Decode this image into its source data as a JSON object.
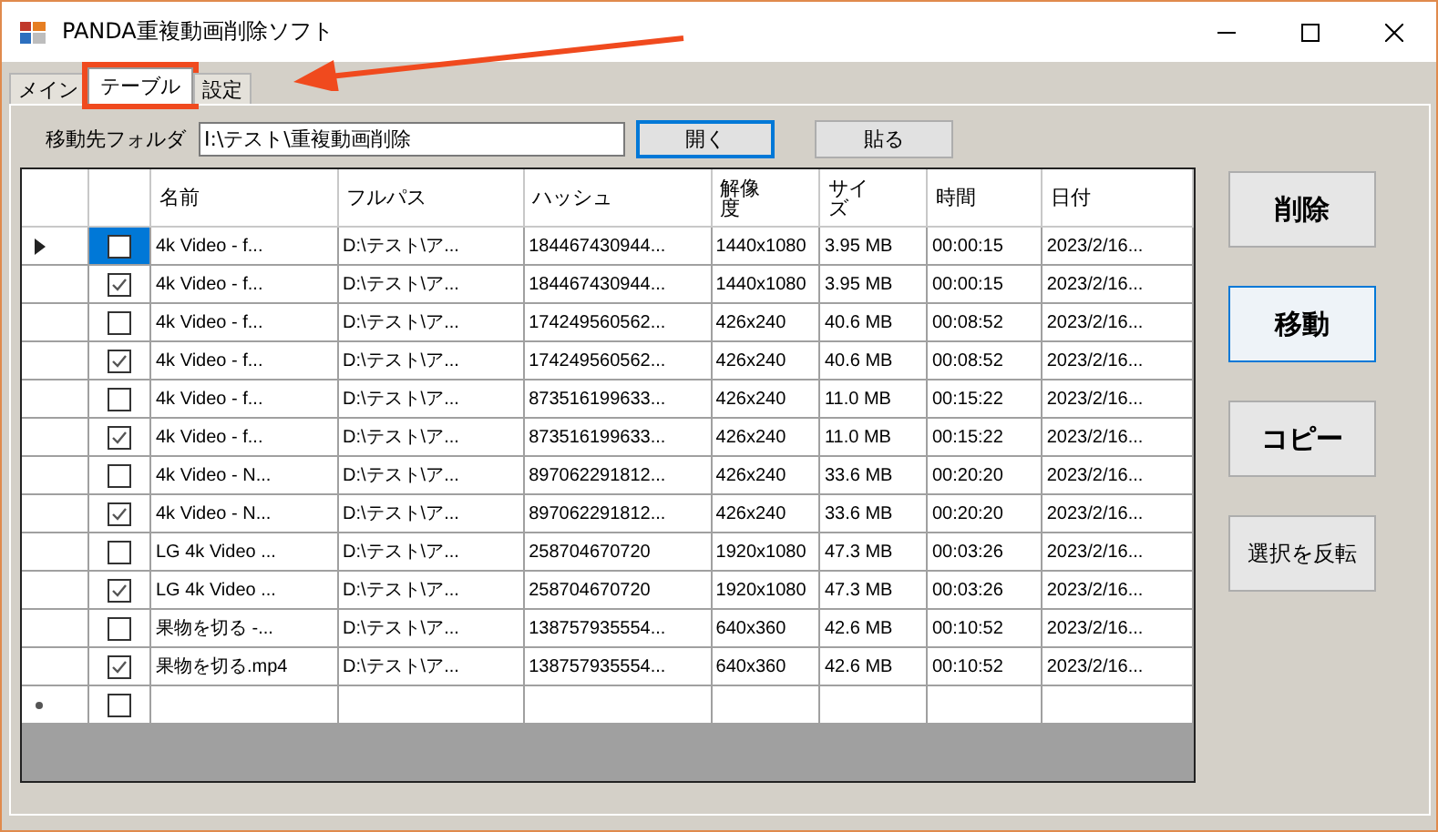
{
  "window": {
    "title": "PANDA重複動画削除ソフト"
  },
  "tabs": [
    {
      "label": "メイン",
      "selected": false
    },
    {
      "label": "テーブル",
      "selected": true,
      "highlighted": true
    },
    {
      "label": "設定",
      "selected": false
    }
  ],
  "folder": {
    "label": "移動先フォルダ",
    "value": "I:\\テスト\\重複動画削除"
  },
  "folder_buttons": [
    {
      "label": "開く",
      "focused": true
    },
    {
      "label": "貼る",
      "focused": false
    }
  ],
  "table": {
    "columns": [
      "名前",
      "フルパス",
      "ハッシュ",
      "解像度",
      "サイズ",
      "時間",
      "日付"
    ],
    "rows": [
      {
        "current": true,
        "checked": false,
        "cells": [
          "4k Video - f...",
          "D:\\テスト\\ア...",
          "184467430944...",
          "1440x1080",
          "3.95 MB",
          "00:00:15",
          "2023/2/16..."
        ]
      },
      {
        "current": false,
        "checked": true,
        "cells": [
          "4k Video - f...",
          "D:\\テスト\\ア...",
          "184467430944...",
          "1440x1080",
          "3.95 MB",
          "00:00:15",
          "2023/2/16..."
        ]
      },
      {
        "current": false,
        "checked": false,
        "cells": [
          "4k Video - f...",
          "D:\\テスト\\ア...",
          "174249560562...",
          "426x240",
          "40.6 MB",
          "00:08:52",
          "2023/2/16..."
        ]
      },
      {
        "current": false,
        "checked": true,
        "cells": [
          "4k Video - f...",
          "D:\\テスト\\ア...",
          "174249560562...",
          "426x240",
          "40.6 MB",
          "00:08:52",
          "2023/2/16..."
        ]
      },
      {
        "current": false,
        "checked": false,
        "cells": [
          "4k Video - f...",
          "D:\\テスト\\ア...",
          "873516199633...",
          "426x240",
          "11.0 MB",
          "00:15:22",
          "2023/2/16..."
        ]
      },
      {
        "current": false,
        "checked": true,
        "cells": [
          "4k Video - f...",
          "D:\\テスト\\ア...",
          "873516199633...",
          "426x240",
          "11.0 MB",
          "00:15:22",
          "2023/2/16..."
        ]
      },
      {
        "current": false,
        "checked": false,
        "cells": [
          "4k Video - N...",
          "D:\\テスト\\ア...",
          "897062291812...",
          "426x240",
          "33.6 MB",
          "00:20:20",
          "2023/2/16..."
        ]
      },
      {
        "current": false,
        "checked": true,
        "cells": [
          "4k Video - N...",
          "D:\\テスト\\ア...",
          "897062291812...",
          "426x240",
          "33.6 MB",
          "00:20:20",
          "2023/2/16..."
        ]
      },
      {
        "current": false,
        "checked": false,
        "cells": [
          "LG 4k Video ...",
          "D:\\テスト\\ア...",
          "258704670720",
          "1920x1080",
          "47.3 MB",
          "00:03:26",
          "2023/2/16..."
        ]
      },
      {
        "current": false,
        "checked": true,
        "cells": [
          "LG 4k Video ...",
          "D:\\テスト\\ア...",
          "258704670720",
          "1920x1080",
          "47.3 MB",
          "00:03:26",
          "2023/2/16..."
        ]
      },
      {
        "current": false,
        "checked": false,
        "cells": [
          "果物を切る -...",
          "D:\\テスト\\ア...",
          "138757935554...",
          "640x360",
          "42.6 MB",
          "00:10:52",
          "2023/2/16..."
        ]
      },
      {
        "current": false,
        "checked": true,
        "cells": [
          "果物を切る.mp4",
          "D:\\テスト\\ア...",
          "138757935554...",
          "640x360",
          "42.6 MB",
          "00:10:52",
          "2023/2/16..."
        ]
      }
    ],
    "new_row": {
      "checked": false
    }
  },
  "action_buttons": [
    {
      "label": "削除",
      "focused": false
    },
    {
      "label": "移動",
      "focused": true
    },
    {
      "label": "コピー",
      "focused": false
    },
    {
      "label": "選択を反転",
      "focused": false
    }
  ],
  "annotations": [
    {
      "kind": "arrow"
    }
  ]
}
